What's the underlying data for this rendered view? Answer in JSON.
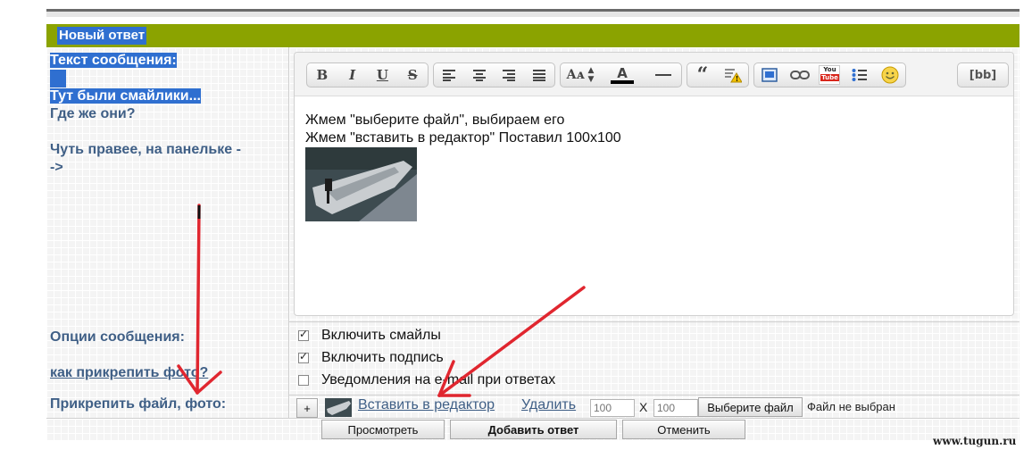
{
  "header": {
    "title": "Новый ответ"
  },
  "left": {
    "message_label": "Текст сообщения:",
    "note_line1": "Тут были смайлики...",
    "note_line2": "Где же они?",
    "note_line3": "Чуть правее, на панельке -",
    "note_line4": "->",
    "options_label": "Опции сообщения:",
    "howto_link": "как прикрепить фото?",
    "attach_label": "Прикрепить файл, фото:"
  },
  "toolbar": {
    "buttons": [
      "bold-icon",
      "italic-icon",
      "underline-icon",
      "strikethrough-icon",
      "align-left-icon",
      "align-center-icon",
      "align-right-icon",
      "align-justify-icon",
      "font-size-icon",
      "font-color-icon",
      "horizontal-rule-icon",
      "quote-icon",
      "spoiler-icon",
      "image-icon",
      "link-icon",
      "youtube-icon",
      "list-icon",
      "smiley-icon"
    ],
    "bold": "B",
    "italic": "I",
    "underline": "U",
    "strike": "S",
    "font_size": "Aᴀ",
    "font_color": "A",
    "youtube": "You\nTube",
    "bb_label": "[bb]"
  },
  "editor": {
    "line1": "Жмем \"выберите файл\", выбираем его",
    "line2": "Жмем \"вставить в редактор\" Поставил 100х100"
  },
  "options": {
    "smiles": {
      "label": "Включить смайлы",
      "checked": true
    },
    "signature": {
      "label": "Включить подпись",
      "checked": true
    },
    "email": {
      "label": "Уведомления на e-mail при ответах",
      "checked": false
    }
  },
  "attach": {
    "plus": "+",
    "insert_link": "Вставить в редактор",
    "delete_link": "Удалить",
    "width_placeholder": "100",
    "height_placeholder": "100",
    "times": "X",
    "choose_button": "Выберите файл",
    "no_file": "Файл не выбран"
  },
  "actions": {
    "preview": "Просмотреть",
    "submit": "Добавить ответ",
    "cancel": "Отменить"
  },
  "watermark": "www.tugun.ru",
  "colors": {
    "header": "#8ba300",
    "selection": "#2f6fd0",
    "label": "#3f5f86",
    "arrow": "#e0262f"
  }
}
